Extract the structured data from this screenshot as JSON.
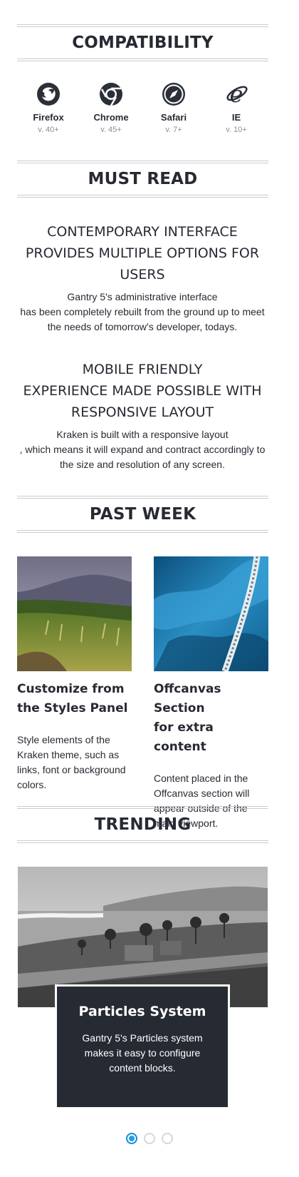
{
  "sections": {
    "compatibility": "COMPATIBILITY",
    "must_read": "MUST READ",
    "past_week": "PAST WEEK",
    "trending": "TRENDING"
  },
  "browsers": [
    {
      "name": "Firefox",
      "version": "v. 40+",
      "icon": "firefox-icon"
    },
    {
      "name": "Chrome",
      "version": "v. 45+",
      "icon": "chrome-icon"
    },
    {
      "name": "Safari",
      "version": "v. 7+",
      "icon": "safari-icon"
    },
    {
      "name": "IE",
      "version": "v. 10+",
      "icon": "ie-icon"
    }
  ],
  "articles": [
    {
      "title_lines": [
        "CONTEMPORARY INTERFACE",
        "PROVIDES MULTIPLE OPTIONS FOR",
        "USERS"
      ],
      "body_lines": [
        "Gantry 5's administrative interface",
        "has been completely rebuilt from the ground up to meet",
        "the needs of tomorrow's developer, todays."
      ]
    },
    {
      "title_lines": [
        "MOBILE FRIENDLY",
        "EXPERIENCE MADE POSSIBLE WITH",
        "RESPONSIVE LAYOUT"
      ],
      "body_lines": [
        "Kraken is built with a responsive layout",
        ", which means it will expand and contract accordingly to",
        "the size and resolution of any screen."
      ]
    }
  ],
  "past_week": [
    {
      "title_lines": [
        "Customize from",
        "the Styles Panel"
      ],
      "body_lines": [
        "Style elements of the",
        "Kraken theme, such as",
        "links, font or background",
        "colors."
      ]
    },
    {
      "title_lines": [
        "Offcanvas Section",
        "for extra content"
      ],
      "body_lines": [
        "Content placed in the",
        "Offcanvas section will",
        "appear outside of the",
        "main viewport."
      ]
    }
  ],
  "trending_slide": {
    "title": "Particles System",
    "body_lines": [
      "Gantry 5's Particles system",
      "makes it easy to configure",
      "content blocks."
    ]
  },
  "carousel": {
    "total": 3,
    "active": 1
  },
  "colors": {
    "text": "#272a33",
    "overlay_bg": "#262a33",
    "dot_active": "#1ea0e6",
    "rule": "#c9ccd1"
  }
}
